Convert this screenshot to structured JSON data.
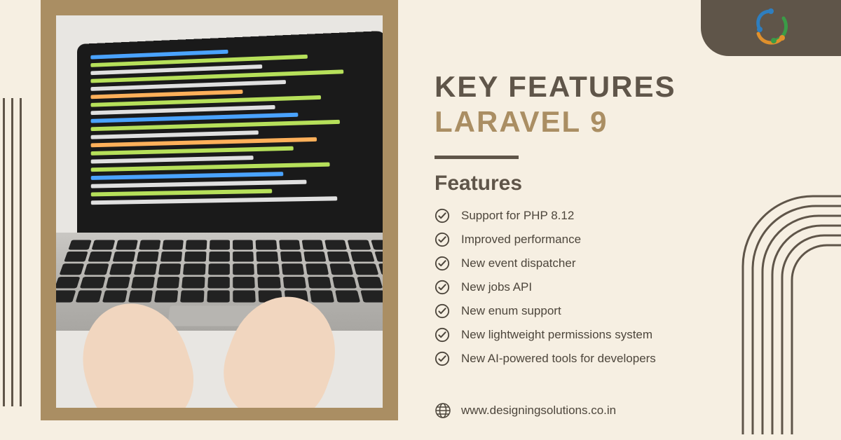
{
  "heading": {
    "line1": "KEY FEATURES",
    "line2": "LARAVEL 9"
  },
  "subheading": "Features",
  "features": [
    "Support for PHP 8.12",
    "Improved performance",
    "New event dispatcher",
    "New jobs API",
    "New enum support",
    "New lightweight permissions system",
    "New AI-powered tools for developers"
  ],
  "website": "www.designingsolutions.co.in",
  "colors": {
    "background": "#f6efe2",
    "dark": "#5f5549",
    "accent": "#aa8e63"
  }
}
